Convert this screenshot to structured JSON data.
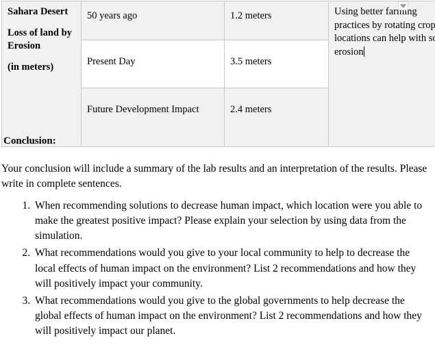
{
  "table": {
    "row_label": {
      "line1": "Sahara Desert",
      "line2": "Loss of land by Erosion",
      "line3": "(in meters)"
    },
    "rows": [
      {
        "stage": "50 years ago",
        "value": "1.2 meters"
      },
      {
        "stage": "Present Day",
        "value": "3.5 meters"
      },
      {
        "stage": "Future Development Impact",
        "value": "2.4 meters"
      }
    ],
    "notes": " Using better farming practices by rotating crop locations can help with soil erosion",
    "dropdown_icon": "chevron-down-icon"
  },
  "conclusion": {
    "heading": "Conclusion:",
    "instructions": "Your conclusion will include a summary of the lab results and an interpretation of the results. Please write in complete sentences.",
    "questions": [
      "When recommending solutions to decrease human impact, which location were you able to make the greatest positive impact? Please explain your selection by using data from the simulation.",
      "What recommendations would you give to your local community to help to decrease the local effects of human impact on the environment? List 2 recommendations and how they will positively impact your community.",
      "What recommendations would you give to the global governments to help decrease the global effects of human impact on the environment? List 2 recommendations and how they will positively impact our planet."
    ]
  }
}
